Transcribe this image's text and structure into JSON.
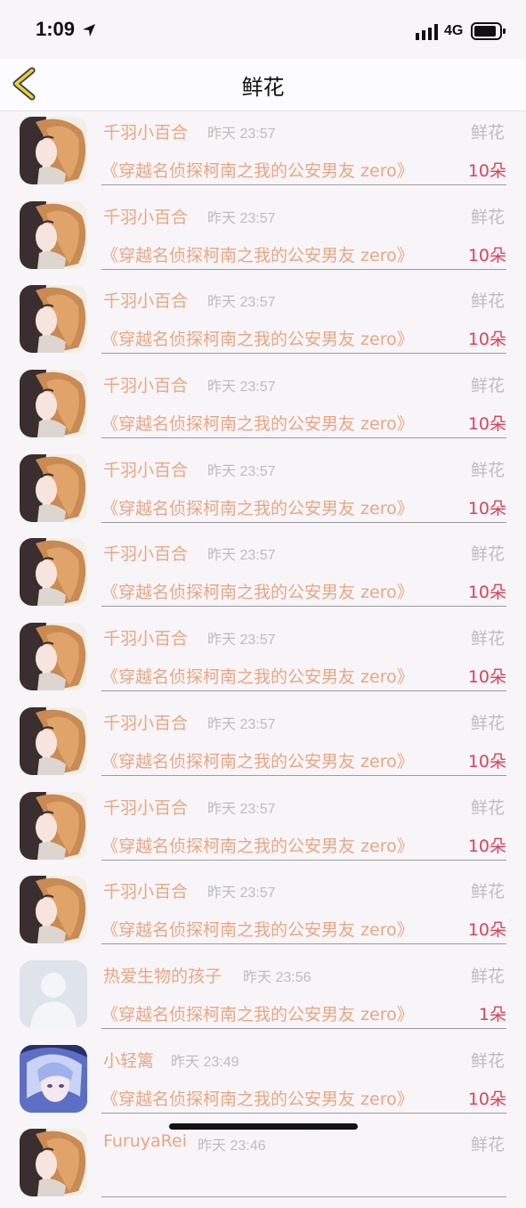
{
  "status_bar": {
    "time": "1:09",
    "network": "4G"
  },
  "nav": {
    "title": "鲜花"
  },
  "entries": [
    {
      "user": "千羽小百合",
      "time": "昨天 23:57",
      "type": "鲜花",
      "book": "《穿越名侦探柯南之我的公安男友 zero》",
      "amount": "10朵",
      "avatar": "anime-girl-avatar"
    },
    {
      "user": "千羽小百合",
      "time": "昨天 23:57",
      "type": "鲜花",
      "book": "《穿越名侦探柯南之我的公安男友 zero》",
      "amount": "10朵",
      "avatar": "anime-girl-avatar"
    },
    {
      "user": "千羽小百合",
      "time": "昨天 23:57",
      "type": "鲜花",
      "book": "《穿越名侦探柯南之我的公安男友 zero》",
      "amount": "10朵",
      "avatar": "anime-girl-avatar"
    },
    {
      "user": "千羽小百合",
      "time": "昨天 23:57",
      "type": "鲜花",
      "book": "《穿越名侦探柯南之我的公安男友 zero》",
      "amount": "10朵",
      "avatar": "anime-girl-avatar"
    },
    {
      "user": "千羽小百合",
      "time": "昨天 23:57",
      "type": "鲜花",
      "book": "《穿越名侦探柯南之我的公安男友 zero》",
      "amount": "10朵",
      "avatar": "anime-girl-avatar"
    },
    {
      "user": "千羽小百合",
      "time": "昨天 23:57",
      "type": "鲜花",
      "book": "《穿越名侦探柯南之我的公安男友 zero》",
      "amount": "10朵",
      "avatar": "anime-girl-avatar"
    },
    {
      "user": "千羽小百合",
      "time": "昨天 23:57",
      "type": "鲜花",
      "book": "《穿越名侦探柯南之我的公安男友 zero》",
      "amount": "10朵",
      "avatar": "anime-girl-avatar"
    },
    {
      "user": "千羽小百合",
      "time": "昨天 23:57",
      "type": "鲜花",
      "book": "《穿越名侦探柯南之我的公安男友 zero》",
      "amount": "10朵",
      "avatar": "anime-girl-avatar"
    },
    {
      "user": "千羽小百合",
      "time": "昨天 23:57",
      "type": "鲜花",
      "book": "《穿越名侦探柯南之我的公安男友 zero》",
      "amount": "10朵",
      "avatar": "anime-girl-avatar"
    },
    {
      "user": "千羽小百合",
      "time": "昨天 23:57",
      "type": "鲜花",
      "book": "《穿越名侦探柯南之我的公安男友 zero》",
      "amount": "10朵",
      "avatar": "anime-girl-avatar"
    },
    {
      "user": "热爱生物的孩子",
      "time": "昨天 23:56",
      "type": "鲜花",
      "book": "《穿越名侦探柯南之我的公安男友 zero》",
      "amount": "1朵",
      "avatar": "default-person-avatar"
    },
    {
      "user": "小轻篱",
      "time": "昨天 23:49",
      "type": "鲜花",
      "book": "《穿越名侦探柯南之我的公安男友 zero》",
      "amount": "10朵",
      "avatar": "blue-hair-anime-avatar"
    },
    {
      "user": "FuruyaRei",
      "time": "昨天 23:46",
      "type": "鲜花",
      "book": "",
      "amount": "",
      "avatar": "anime-girl-avatar"
    }
  ]
}
